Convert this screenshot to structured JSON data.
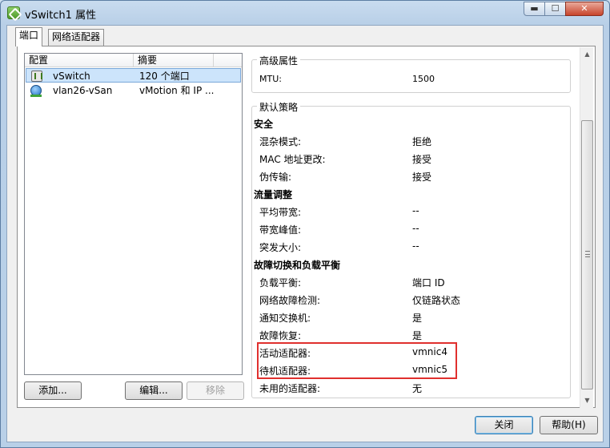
{
  "window": {
    "title": "vSwitch1 属性",
    "min_glyph": "▬",
    "max_glyph": "☐",
    "close_glyph": "✕"
  },
  "tabs": [
    {
      "label": "端口",
      "active": true
    },
    {
      "label": "网络适配器",
      "active": false
    }
  ],
  "config_list": {
    "columns": [
      "配置",
      "摘要"
    ],
    "rows": [
      {
        "icon": "vswitch-icon",
        "name": "vSwitch",
        "summary": "120 个端口",
        "selected": true
      },
      {
        "icon": "vmkernel-icon",
        "name": "vlan26-vSan",
        "summary": "vMotion 和 IP ...",
        "selected": false
      }
    ]
  },
  "list_buttons": {
    "add": "添加...",
    "edit": "编辑...",
    "remove": "移除"
  },
  "advanced": {
    "title": "高级属性",
    "mtu_label": "MTU:",
    "mtu_value": "1500"
  },
  "default_policy": {
    "title": "默认策略",
    "security": {
      "heading": "安全",
      "items": [
        {
          "label": "混杂模式:",
          "value": "拒绝"
        },
        {
          "label": "MAC 地址更改:",
          "value": "接受"
        },
        {
          "label": "伪传输:",
          "value": "接受"
        }
      ]
    },
    "traffic_shaping": {
      "heading": "流量调整",
      "items": [
        {
          "label": "平均带宽:",
          "value": "--"
        },
        {
          "label": "带宽峰值:",
          "value": "--"
        },
        {
          "label": "突发大小:",
          "value": "--"
        }
      ]
    },
    "failover": {
      "heading": "故障切换和负载平衡",
      "items": [
        {
          "label": "负载平衡:",
          "value": "端口 ID"
        },
        {
          "label": "网络故障检测:",
          "value": "仅链路状态"
        },
        {
          "label": "通知交换机:",
          "value": "是"
        },
        {
          "label": "故障恢复:",
          "value": "是"
        },
        {
          "label": "活动适配器:",
          "value": "vmnic4"
        },
        {
          "label": "待机适配器:",
          "value": "vmnic5"
        },
        {
          "label": "未用的适配器:",
          "value": "无"
        }
      ]
    }
  },
  "scrollbar": {
    "up_glyph": "▲",
    "down_glyph": "▼"
  },
  "footer": {
    "close": "关闭",
    "help": "帮助(H)"
  },
  "colors": {
    "highlight": "#e0302e",
    "selection": "#cce4fb"
  }
}
